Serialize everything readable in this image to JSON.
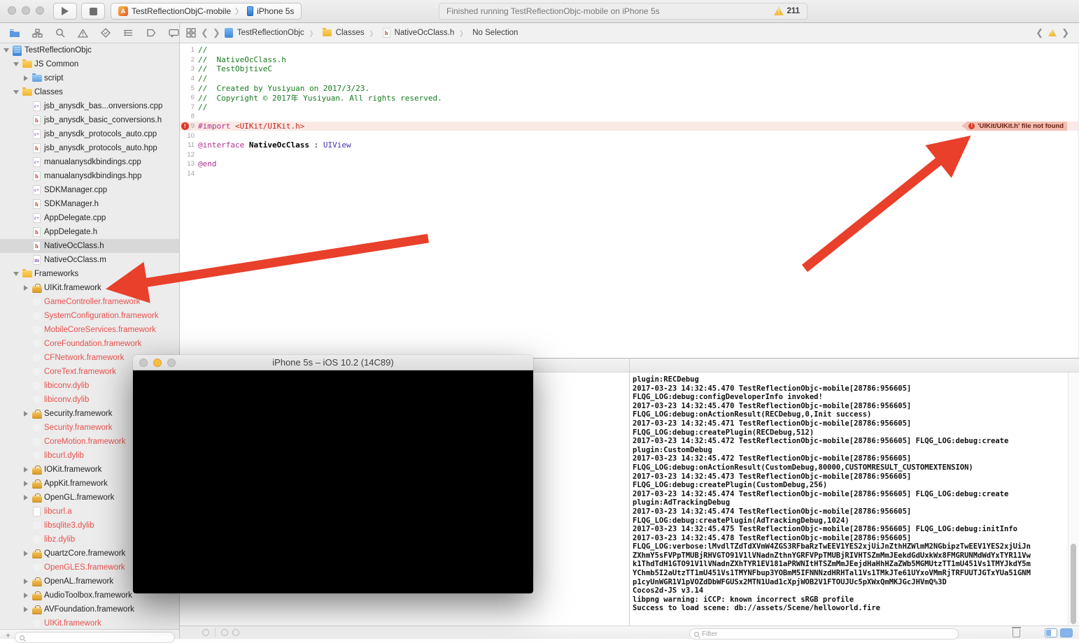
{
  "toolbar": {
    "scheme_name": "TestReflectionObjC-mobile",
    "device_name": "iPhone 5s",
    "status_text": "Finished running TestReflectionObjc-mobile on iPhone 5s",
    "warning_count": "211"
  },
  "jump_bar": {
    "project": "TestReflectionObjc",
    "group": "Classes",
    "file": "NativeOcClass.h",
    "selection": "No Selection"
  },
  "sidebar": {
    "items": [
      {
        "label": "TestReflectionObjc",
        "level": 0,
        "icon": "project",
        "disc": "down"
      },
      {
        "label": "JS Common",
        "level": 1,
        "icon": "folder-y",
        "disc": "down"
      },
      {
        "label": "script",
        "level": 2,
        "icon": "folder-b",
        "disc": "right"
      },
      {
        "label": "Classes",
        "level": 1,
        "icon": "folder-y",
        "disc": "down"
      },
      {
        "label": "jsb_anysdk_bas...onversions.cpp",
        "level": 2,
        "icon": "cpp"
      },
      {
        "label": "jsb_anysdk_basic_conversions.h",
        "level": 2,
        "icon": "h"
      },
      {
        "label": "jsb_anysdk_protocols_auto.cpp",
        "level": 2,
        "icon": "cpp"
      },
      {
        "label": "jsb_anysdk_protocols_auto.hpp",
        "level": 2,
        "icon": "h"
      },
      {
        "label": "manualanysdkbindings.cpp",
        "level": 2,
        "icon": "cpp"
      },
      {
        "label": "manualanysdkbindings.hpp",
        "level": 2,
        "icon": "h"
      },
      {
        "label": "SDKManager.cpp",
        "level": 2,
        "icon": "cpp"
      },
      {
        "label": "SDKManager.h",
        "level": 2,
        "icon": "h"
      },
      {
        "label": "AppDelegate.cpp",
        "level": 2,
        "icon": "cpp"
      },
      {
        "label": "AppDelegate.h",
        "level": 2,
        "icon": "h"
      },
      {
        "label": "NativeOcClass.h",
        "level": 2,
        "icon": "h",
        "selected": true
      },
      {
        "label": "NativeOcClass.m",
        "level": 2,
        "icon": "m"
      },
      {
        "label": "Frameworks",
        "level": 1,
        "icon": "folder-y",
        "disc": "down"
      },
      {
        "label": "UIKit.framework",
        "level": 2,
        "icon": "fw",
        "disc": "right"
      },
      {
        "label": "GameController.framework",
        "level": 2,
        "icon": "ghost",
        "red": true
      },
      {
        "label": "SystemConfiguration.framework",
        "level": 2,
        "icon": "ghost",
        "red": true
      },
      {
        "label": "MobileCoreServices.framework",
        "level": 2,
        "icon": "ghost",
        "red": true
      },
      {
        "label": "CoreFoundation.framework",
        "level": 2,
        "icon": "ghost",
        "red": true
      },
      {
        "label": "CFNetwork.framework",
        "level": 2,
        "icon": "ghost",
        "red": true
      },
      {
        "label": "CoreText.framework",
        "level": 2,
        "icon": "ghost",
        "red": true
      },
      {
        "label": "libiconv.dylib",
        "level": 2,
        "icon": "ghost",
        "red": true
      },
      {
        "label": "libiconv.dylib",
        "level": 2,
        "icon": "ghost",
        "red": true
      },
      {
        "label": "Security.framework",
        "level": 2,
        "icon": "fw",
        "disc": "right"
      },
      {
        "label": "Security.framework",
        "level": 2,
        "icon": "ghost",
        "red": true
      },
      {
        "label": "CoreMotion.framework",
        "level": 2,
        "icon": "ghost",
        "red": true
      },
      {
        "label": "libcurl.dylib",
        "level": 2,
        "icon": "ghost",
        "red": true
      },
      {
        "label": "IOKit.framework",
        "level": 2,
        "icon": "fw",
        "disc": "right"
      },
      {
        "label": "AppKit.framework",
        "level": 2,
        "icon": "fw",
        "disc": "right"
      },
      {
        "label": "OpenGL.framework",
        "level": 2,
        "icon": "fw",
        "disc": "right"
      },
      {
        "label": "libcurl.a",
        "level": 2,
        "icon": "doc",
        "red": true
      },
      {
        "label": "libsqlite3.dylib",
        "level": 2,
        "icon": "ghost",
        "red": true
      },
      {
        "label": "libz.dylib",
        "level": 2,
        "icon": "ghost",
        "red": true
      },
      {
        "label": "QuartzCore.framework",
        "level": 2,
        "icon": "fw",
        "disc": "right"
      },
      {
        "label": "OpenGLES.framework",
        "level": 2,
        "icon": "ghost",
        "red": true
      },
      {
        "label": "OpenAL.framework",
        "level": 2,
        "icon": "fw",
        "disc": "right"
      },
      {
        "label": "AudioToolbox.framework",
        "level": 2,
        "icon": "fw",
        "disc": "right"
      },
      {
        "label": "AVFoundation.framework",
        "level": 2,
        "icon": "fw",
        "disc": "right"
      },
      {
        "label": "UIKit.framework",
        "level": 2,
        "icon": "ghost",
        "red": true
      }
    ]
  },
  "editor": {
    "error_line": 9,
    "error_banner_text": "'UIKit/UIKit.h' file not found",
    "lines": [
      {
        "n": 1,
        "segs": [
          [
            "cm",
            "//"
          ]
        ]
      },
      {
        "n": 2,
        "segs": [
          [
            "cm",
            "//  NativeOcClass.h"
          ]
        ]
      },
      {
        "n": 3,
        "segs": [
          [
            "cm",
            "//  TestObjtiveC"
          ]
        ]
      },
      {
        "n": 4,
        "segs": [
          [
            "cm",
            "//"
          ]
        ]
      },
      {
        "n": 5,
        "segs": [
          [
            "cm",
            "//  Created by Yusiyuan on 2017/3/23."
          ]
        ]
      },
      {
        "n": 6,
        "segs": [
          [
            "cm",
            "//  Copyright © 2017年 Yusiyuan. All rights reserved."
          ]
        ]
      },
      {
        "n": 7,
        "segs": [
          [
            "cm",
            "//"
          ]
        ]
      },
      {
        "n": 8,
        "segs": []
      },
      {
        "n": 9,
        "segs": [
          [
            "pp",
            "#import "
          ],
          [
            "red",
            "<UIKit/UIKit.h>"
          ]
        ]
      },
      {
        "n": 10,
        "segs": []
      },
      {
        "n": 11,
        "segs": [
          [
            "pp",
            "@interface "
          ],
          [
            "plainb",
            "NativeOcClass "
          ],
          [
            "plain",
            ": "
          ],
          [
            "cls",
            "UIView"
          ]
        ]
      },
      {
        "n": 12,
        "segs": []
      },
      {
        "n": 13,
        "segs": [
          [
            "pp",
            "@end"
          ]
        ]
      },
      {
        "n": 14,
        "segs": []
      }
    ]
  },
  "simulator": {
    "title": "iPhone 5s – iOS 10.2 (14C89)"
  },
  "console": {
    "lines": [
      "plugin:RECDebug",
      "2017-03-23 14:32:45.470 TestReflectionObjc-mobile[28786:956605]",
      "FLQG_LOG:debug:configDeveloperInfo invoked!",
      "2017-03-23 14:32:45.470 TestReflectionObjc-mobile[28786:956605]",
      "FLQG_LOG:debug:onActionResult(RECDebug,0,Init success)",
      "2017-03-23 14:32:45.471 TestReflectionObjc-mobile[28786:956605]",
      "FLQG_LOG:debug:createPlugin(RECDebug,512)",
      "2017-03-23 14:32:45.472 TestReflectionObjc-mobile[28786:956605] FLQG_LOG:debug:create",
      "plugin:CustomDebug",
      "2017-03-23 14:32:45.472 TestReflectionObjc-mobile[28786:956605]",
      "FLQG_LOG:debug:onActionResult(CustomDebug,80000,CUSTOMRESULT_CUSTOMEXTENSION)",
      "2017-03-23 14:32:45.473 TestReflectionObjc-mobile[28786:956605]",
      "FLQG_LOG:debug:createPlugin(CustomDebug,256)",
      "2017-03-23 14:32:45.474 TestReflectionObjc-mobile[28786:956605] FLQG_LOG:debug:create",
      "plugin:AdTrackingDebug",
      "2017-03-23 14:32:45.474 TestReflectionObjc-mobile[28786:956605]",
      "FLQG_LOG:debug:createPlugin(AdTrackingDebug,1024)",
      "2017-03-23 14:32:45.475 TestReflectionObjc-mobile[28786:956605] FLQG_LOG:debug:initInfo",
      "2017-03-23 14:32:45.478 TestReflectionObjc-mobile[28786:956605]",
      "FLQG_LOG:verbose:lMvdlTZdTdXVmW4ZGS3RFbaRzTwEEV1YES2xjUiJnZthHZWlmM2NGbipzTwEEV1YES2xjUiJn",
      "ZXhmY5sFVPpTMUBjRHVGTO91V1lVNadnZthnYGRFVPpTMUBjRIVHTSZmMmJEekdGdUxkWx8FMGRUNMdWdYxTYR11Vw",
      "k1ThdTdH1GTO91V1lVNadnZXhTYR1EV181aPRWNItHTSZmMmJEejdHaHhHZaZWb5MGMUtzTT1mU451Vs1TMYJkdY5m",
      "YChmb5I2aUtzTT1mU451Vs1TMYNFbup3YOBmM5IFNNNzdHRHTal1Vs1TMkJTe61UYxoVMmRjTRFUUTJGTxYUa51GNM",
      "p1cyUnWGR1V1pVOZdDbWFGUSx2MTN1Uad1cXpjWOB2V1FTOUJUc5pXWxQmMKJGcJHVmQ%3D",
      "Cocos2d-JS v3.14",
      "libpng warning: iCCP: known incorrect sRGB profile",
      "Success to load scene: db://assets/Scene/helloworld.fire"
    ]
  },
  "debug_bar": {
    "filter_placeholder": "Filter"
  },
  "colors": {
    "arrow_red": "#e8402b",
    "error_row_bg": "#fbe9e5",
    "error_banner_bg": "#f3beb2",
    "warning_yellow": "#f1bf45",
    "missing_item_red": "#e8514d",
    "folder_yellow": "#f0b62f",
    "navigator_accent_blue": "#4a90e2"
  }
}
